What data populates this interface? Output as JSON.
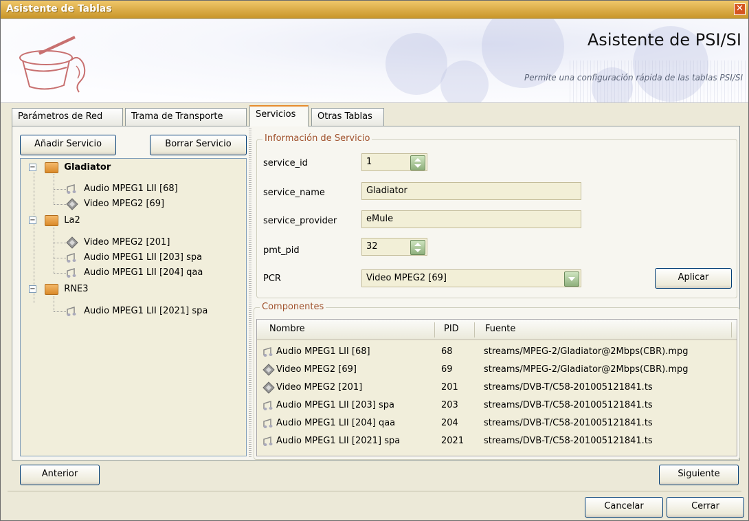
{
  "window": {
    "title": "Asistente de Tablas",
    "close_icon": "close-icon"
  },
  "banner": {
    "heading": "Asistente de PSI/SI",
    "subheading": "Permite una configuración rápida de las tablas PSI/SI",
    "logo_icon": "magic-hat-icon"
  },
  "tabs": [
    {
      "label": "Parámetros de Red",
      "active": false
    },
    {
      "label": "Trama de Transporte",
      "active": false
    },
    {
      "label": "Servicios",
      "active": true
    },
    {
      "label": "Otras Tablas",
      "active": false
    }
  ],
  "services_panel": {
    "add_label": "Añadir Servicio",
    "delete_label": "Borrar Servicio",
    "tree": [
      {
        "label": "Gladiator",
        "expanded": true,
        "bold": true,
        "children": [
          {
            "label": "Audio MPEG1 LII [68]",
            "icon": "audio-icon"
          },
          {
            "label": "Video MPEG2 [69]",
            "icon": "video-icon"
          }
        ]
      },
      {
        "label": "La2",
        "expanded": true,
        "bold": false,
        "children": [
          {
            "label": "Video MPEG2 [201]",
            "icon": "video-icon"
          },
          {
            "label": "Audio MPEG1 LII [203] spa",
            "icon": "audio-icon"
          },
          {
            "label": "Audio MPEG1 LII [204] qaa",
            "icon": "audio-icon"
          }
        ]
      },
      {
        "label": "RNE3",
        "expanded": true,
        "bold": false,
        "children": [
          {
            "label": "Audio MPEG1 LII [2021] spa",
            "icon": "audio-icon"
          }
        ]
      }
    ]
  },
  "service_info": {
    "legend": "Información de Servicio",
    "service_id_label": "service_id",
    "service_id_value": "1",
    "service_name_label": "service_name",
    "service_name_value": "Gladiator",
    "service_provider_label": "service_provider",
    "service_provider_value": "eMule",
    "pmt_pid_label": "pmt_pid",
    "pmt_pid_value": "32",
    "pcr_label": "PCR",
    "pcr_value": "Video MPEG2 [69]",
    "apply_label": "Aplicar"
  },
  "components": {
    "legend": "Componentes",
    "columns": [
      "Nombre",
      "PID",
      "Fuente"
    ],
    "rows": [
      {
        "icon": "audio-icon",
        "name": "Audio MPEG1 LII [68]",
        "pid": "68",
        "source": "streams/MPEG-2/Gladiator@2Mbps(CBR).mpg"
      },
      {
        "icon": "video-icon",
        "name": "Video MPEG2 [69]",
        "pid": "69",
        "source": "streams/MPEG-2/Gladiator@2Mbps(CBR).mpg"
      },
      {
        "icon": "video-icon",
        "name": "Video MPEG2 [201]",
        "pid": "201",
        "source": "streams/DVB-T/C58-201005121841.ts"
      },
      {
        "icon": "audio-icon",
        "name": "Audio MPEG1 LII [203] spa",
        "pid": "203",
        "source": "streams/DVB-T/C58-201005121841.ts"
      },
      {
        "icon": "audio-icon",
        "name": "Audio MPEG1 LII [204] qaa",
        "pid": "204",
        "source": "streams/DVB-T/C58-201005121841.ts"
      },
      {
        "icon": "audio-icon",
        "name": "Audio MPEG1 LII [2021] spa",
        "pid": "2021",
        "source": "streams/DVB-T/C58-201005121841.ts"
      }
    ]
  },
  "nav": {
    "previous_label": "Anterior",
    "next_label": "Siguiente"
  },
  "footer": {
    "cancel_label": "Cancelar",
    "close_label": "Cerrar"
  }
}
